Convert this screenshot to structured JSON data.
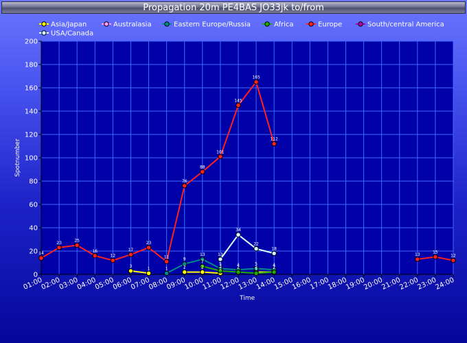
{
  "chart_data": {
    "type": "line",
    "title": "Propagation 20m PE4BAS JO33jk to/from",
    "xlabel": "Time",
    "ylabel": "Spotnumber",
    "ylim": [
      0,
      200
    ],
    "yticks": [
      "0",
      "20",
      "40",
      "60",
      "80",
      "100",
      "120",
      "140",
      "160",
      "180",
      "200"
    ],
    "categories": [
      "01:00",
      "02:00",
      "03:00",
      "04:00",
      "05:00",
      "06:00",
      "07:00",
      "08:00",
      "09:00",
      "10:00",
      "11:00",
      "12:00",
      "13:00",
      "14:00",
      "15:00",
      "16:00",
      "17:00",
      "18:00",
      "19:00",
      "20:00",
      "21:00",
      "22:00",
      "23:00",
      "24:00"
    ],
    "grid": true,
    "legend_position": "top",
    "series": [
      {
        "name": "Asia/Japan",
        "color": "#ffff00",
        "values": [
          null,
          null,
          null,
          null,
          null,
          3,
          1,
          null,
          2,
          2,
          1,
          null,
          2,
          2,
          null,
          null,
          null,
          null,
          null,
          null,
          null,
          null,
          null,
          null
        ],
        "labels": [
          null,
          null,
          null,
          null,
          null,
          "3",
          "1",
          null,
          "2",
          "2",
          "1",
          null,
          "2",
          "2",
          null,
          null,
          null,
          null,
          null,
          null,
          null,
          null,
          null,
          null
        ]
      },
      {
        "name": "Australasia",
        "color": "#ff99ff",
        "values": [
          null,
          null,
          null,
          null,
          null,
          null,
          null,
          null,
          null,
          null,
          null,
          null,
          null,
          null,
          null,
          null,
          null,
          null,
          null,
          null,
          null,
          null,
          null,
          null
        ],
        "labels": []
      },
      {
        "name": "Eastern Europe/Russia",
        "color": "#008b8b",
        "values": [
          null,
          null,
          null,
          null,
          null,
          null,
          null,
          1,
          9,
          13,
          5,
          4,
          5,
          4,
          null,
          null,
          null,
          null,
          null,
          null,
          null,
          null,
          null,
          null
        ],
        "labels": [
          null,
          null,
          null,
          null,
          null,
          null,
          null,
          "1",
          "9",
          "13",
          "5",
          "4",
          "5",
          "4",
          null,
          null,
          null,
          null,
          null,
          null,
          null,
          null,
          null,
          null
        ]
      },
      {
        "name": "Africa",
        "color": "#22aa00",
        "values": [
          null,
          null,
          null,
          null,
          null,
          null,
          null,
          null,
          null,
          7,
          3,
          2,
          1,
          2,
          null,
          null,
          null,
          null,
          null,
          null,
          null,
          null,
          null,
          null
        ],
        "labels": [
          null,
          null,
          null,
          null,
          null,
          null,
          null,
          null,
          null,
          "7",
          "3",
          "2",
          "1",
          "2",
          null,
          null,
          null,
          null,
          null,
          null,
          null,
          null,
          null,
          null
        ]
      },
      {
        "name": "Europe",
        "color": "#ff2020",
        "values": [
          14,
          23,
          25,
          16,
          12,
          17,
          23,
          11,
          76,
          88,
          101,
          145,
          165,
          112,
          null,
          null,
          null,
          null,
          null,
          null,
          null,
          13,
          15,
          12
        ],
        "labels": [
          "14",
          "23",
          "25",
          "16",
          "12",
          "17",
          "23",
          "11",
          "76",
          "88",
          "101",
          "145",
          "165",
          "112",
          null,
          null,
          null,
          null,
          null,
          null,
          null,
          "13",
          "15",
          "12"
        ]
      },
      {
        "name": "South/central America",
        "color": "#b000b0",
        "values": [
          null,
          null,
          null,
          null,
          null,
          null,
          null,
          null,
          null,
          null,
          null,
          null,
          null,
          null,
          null,
          null,
          null,
          null,
          null,
          null,
          null,
          null,
          null,
          null
        ],
        "labels": []
      },
      {
        "name": "USA/Canada",
        "color": "#d8ffff",
        "values": [
          null,
          null,
          null,
          null,
          null,
          null,
          null,
          null,
          null,
          null,
          13,
          34,
          22,
          18,
          null,
          null,
          null,
          null,
          null,
          null,
          null,
          null,
          null,
          null
        ],
        "labels": [
          null,
          null,
          null,
          null,
          null,
          null,
          null,
          null,
          null,
          null,
          "13",
          "34",
          "22",
          "18",
          null,
          null,
          null,
          null,
          null,
          null,
          null,
          null,
          null,
          null
        ]
      }
    ]
  }
}
